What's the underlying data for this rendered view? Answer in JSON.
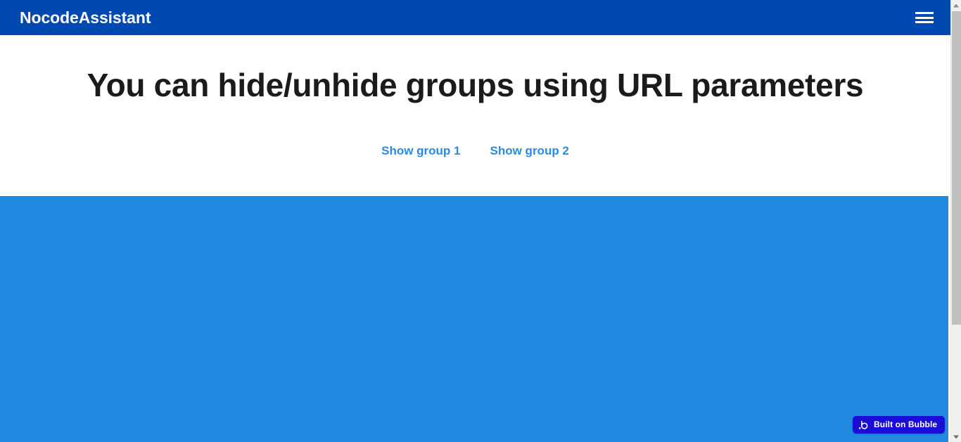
{
  "header": {
    "brand": "NocodeAssistant",
    "menu_icon": "hamburger-menu-icon",
    "background_color": "#0049b0",
    "text_color": "#ffffff"
  },
  "hero": {
    "title": "You can hide/unhide groups using URL parameters",
    "title_color": "#1b1b1b",
    "links": [
      {
        "label": "Show group 1",
        "color": "#2c8ae6"
      },
      {
        "label": "Show group 2",
        "color": "#2c8ae6"
      }
    ]
  },
  "blue_section": {
    "background_color": "#2089e0"
  },
  "badge": {
    "label": "Built on Bubble",
    "icon": "bubble-logo-icon",
    "background_color": "#1a0dd8",
    "text_color": "#ffffff"
  },
  "scrollbar": {
    "up_arrow_icon": "scroll-up-arrow-icon",
    "down_arrow_icon": "scroll-down-arrow-icon",
    "track_color": "#f0f0f0",
    "thumb_color": "#c0c0c0"
  }
}
